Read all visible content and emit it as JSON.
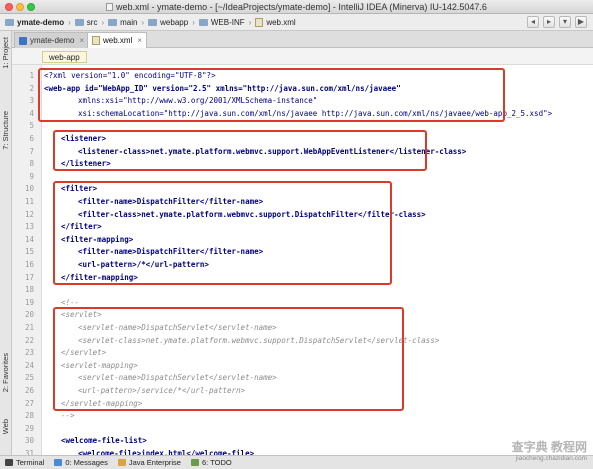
{
  "window": {
    "title": "web.xml - ymate-demo - [~/IdeaProjects/ymate-demo] - IntelliJ IDEA (Minerva) IU-142.5047.6"
  },
  "breadcrumb": {
    "items": [
      {
        "label": "ymate-demo",
        "bold": true,
        "icon": "folder-icon"
      },
      {
        "label": "src",
        "icon": "folder-icon"
      },
      {
        "label": "main",
        "icon": "folder-icon"
      },
      {
        "label": "webapp",
        "icon": "folder-icon"
      },
      {
        "label": "WEB-INF",
        "icon": "folder-icon"
      },
      {
        "label": "web.xml",
        "icon": "xml-file-icon"
      }
    ]
  },
  "left_tools": {
    "project": "1: Project",
    "structure": "7: Structure",
    "favorites": "2: Favorites",
    "web": "Web"
  },
  "editor_tabs": [
    {
      "label": "ymate-demo",
      "active": false,
      "icon": "module-icon"
    },
    {
      "label": "web.xml",
      "active": true,
      "icon": "xml-file-icon"
    }
  ],
  "editor_header": {
    "context": "web-app"
  },
  "code_lines": [
    {
      "n": "1",
      "text": "<?xml version=\"1.0\" encoding=\"UTF-8\"?>",
      "style": "decl",
      "indent": 0
    },
    {
      "n": "2",
      "text": "<web-app id=\"WebApp_ID\" version=\"2.5\" xmlns=\"http://java.sun.com/xml/ns/javaee\"",
      "style": "tagline",
      "indent": 0
    },
    {
      "n": "3",
      "text": "xmlns:xsi=\"http://www.w3.org/2001/XMLSchema-instance\"",
      "style": "decl",
      "indent": 2
    },
    {
      "n": "4",
      "text": "xsi:schemaLocation=\"http://java.sun.com/xml/ns/javaee http://java.sun.com/xml/ns/javaee/web-app_2_5.xsd\">",
      "style": "decl",
      "indent": 2
    },
    {
      "n": "5",
      "text": "",
      "style": "plain",
      "indent": 0
    },
    {
      "n": "6",
      "text": "<listener>",
      "style": "tagline",
      "indent": 1
    },
    {
      "n": "7",
      "text": "<listener-class>net.ymate.platform.webmvc.support.WebAppEventListener</listener-class>",
      "style": "tagline",
      "indent": 2
    },
    {
      "n": "8",
      "text": "</listener>",
      "style": "tagline",
      "indent": 1
    },
    {
      "n": "9",
      "text": "",
      "style": "plain",
      "indent": 0
    },
    {
      "n": "10",
      "text": "<filter>",
      "style": "tagline",
      "indent": 1
    },
    {
      "n": "11",
      "text": "<filter-name>DispatchFilter</filter-name>",
      "style": "tagline",
      "indent": 2
    },
    {
      "n": "12",
      "text": "<filter-class>net.ymate.platform.webmvc.support.DispatchFilter</filter-class>",
      "style": "tagline",
      "indent": 2
    },
    {
      "n": "13",
      "text": "</filter>",
      "style": "tagline",
      "indent": 1
    },
    {
      "n": "14",
      "text": "<filter-mapping>",
      "style": "tagline",
      "indent": 1
    },
    {
      "n": "15",
      "text": "<filter-name>DispatchFilter</filter-name>",
      "style": "tagline",
      "indent": 2
    },
    {
      "n": "16",
      "text": "<url-pattern>/*</url-pattern>",
      "style": "tagline",
      "indent": 2
    },
    {
      "n": "17",
      "text": "</filter-mapping>",
      "style": "tagline",
      "indent": 1
    },
    {
      "n": "18",
      "text": "",
      "style": "plain",
      "indent": 0
    },
    {
      "n": "19",
      "text": "<!--",
      "style": "comment",
      "indent": 1
    },
    {
      "n": "20",
      "text": "<servlet>",
      "style": "comment",
      "indent": 1
    },
    {
      "n": "21",
      "text": "<servlet-name>DispatchServlet</servlet-name>",
      "style": "comment",
      "indent": 2
    },
    {
      "n": "22",
      "text": "<servlet-class>net.ymate.platform.webmvc.support.DispatchServlet</servlet-class>",
      "style": "comment",
      "indent": 2
    },
    {
      "n": "23",
      "text": "</servlet>",
      "style": "comment",
      "indent": 1
    },
    {
      "n": "24",
      "text": "<servlet-mapping>",
      "style": "comment",
      "indent": 1
    },
    {
      "n": "25",
      "text": "<servlet-name>DispatchServlet</servlet-name>",
      "style": "comment",
      "indent": 2
    },
    {
      "n": "26",
      "text": "<url-pattern>/service/*</url-pattern>",
      "style": "comment",
      "indent": 2
    },
    {
      "n": "27",
      "text": "</servlet-mapping>",
      "style": "comment",
      "indent": 1
    },
    {
      "n": "28",
      "text": "-->",
      "style": "comment",
      "indent": 1
    },
    {
      "n": "29",
      "text": "",
      "style": "plain",
      "indent": 0
    },
    {
      "n": "30",
      "text": "<welcome-file-list>",
      "style": "tagline",
      "indent": 1
    },
    {
      "n": "31",
      "text": "<welcome-file>index.html</welcome-file>",
      "style": "tagline",
      "indent": 2
    }
  ],
  "bottom_tools": [
    {
      "label": "Terminal",
      "icon": "terminal-icon"
    },
    {
      "label": "0: Messages",
      "icon": "messages-icon"
    },
    {
      "label": "Java Enterprise",
      "icon": "java-enterprise-icon"
    },
    {
      "label": "6: TODO",
      "icon": "todo-icon"
    }
  ],
  "watermark": {
    "main": "查字典 教程网",
    "sub": "jiaocheng.chazidian.com"
  },
  "colors": {
    "highlight_box": "#d93a2b",
    "tag": "#000080",
    "comment": "#8c8c8c"
  }
}
